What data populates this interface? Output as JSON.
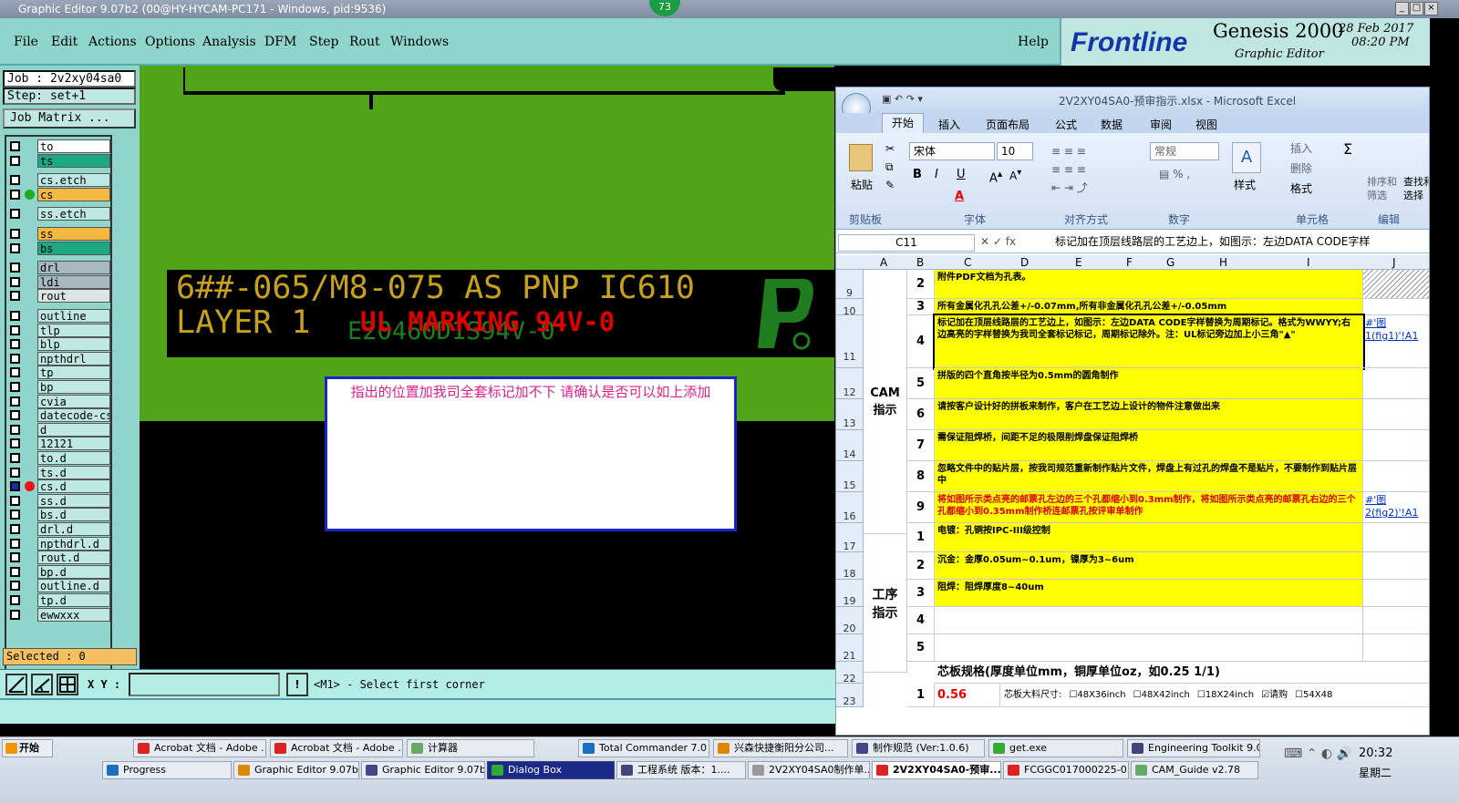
{
  "window": {
    "title": "Graphic Editor 9.07b2 (00@HY-HYCAM-PC171 - Windows, pid:9536)",
    "badge": "73"
  },
  "menu": {
    "items": [
      "File",
      "Edit",
      "Actions",
      "Options",
      "Analysis",
      "DFM",
      "Step",
      "Rout",
      "Windows"
    ],
    "help": "Help"
  },
  "brand": {
    "logo": "Frontline",
    "product": "Genesis 2000",
    "subtitle": "Graphic Editor",
    "date": "28 Feb 2017",
    "time": "08:20 PM"
  },
  "left": {
    "job": "Job : 2v2xy04sa0",
    "step": "Step: set+1",
    "job_matrix": "Job Matrix ...",
    "selected": "Selected : 0"
  },
  "layers": [
    {
      "name": "to",
      "color": "#ffffff"
    },
    {
      "name": "ts",
      "color": "#1ea884"
    },
    {
      "name": "cs.etch",
      "color": "#bfe8e3"
    },
    {
      "name": "cs",
      "color": "#f5b942"
    },
    {
      "name": "ss.etch",
      "color": "#bfe8e3"
    },
    {
      "name": "ss",
      "color": "#f5b942"
    },
    {
      "name": "bs",
      "color": "#1ea884"
    },
    {
      "name": "drl",
      "color": "#a8b8c0"
    },
    {
      "name": "ldi",
      "color": "#a8b8c0"
    },
    {
      "name": "rout",
      "color": "#dde4e6"
    },
    {
      "name": "outline",
      "color": "#bfe8e3"
    },
    {
      "name": "tlp",
      "color": "#bfe8e3"
    },
    {
      "name": "blp",
      "color": "#bfe8e3"
    },
    {
      "name": "npthdrl",
      "color": "#bfe8e3"
    },
    {
      "name": "tp",
      "color": "#bfe8e3"
    },
    {
      "name": "bp",
      "color": "#bfe8e3"
    },
    {
      "name": "cvia",
      "color": "#bfe8e3"
    },
    {
      "name": "datecode-cs",
      "color": "#bfe8e3"
    },
    {
      "name": "d",
      "color": "#bfe8e3"
    },
    {
      "name": "12121",
      "color": "#bfe8e3"
    },
    {
      "name": "to.d",
      "color": "#bfe8e3"
    },
    {
      "name": "ts.d",
      "color": "#bfe8e3"
    },
    {
      "name": "cs.d",
      "color": "#bfe8e3"
    },
    {
      "name": "ss.d",
      "color": "#bfe8e3"
    },
    {
      "name": "bs.d",
      "color": "#bfe8e3"
    },
    {
      "name": "drl.d",
      "color": "#bfe8e3"
    },
    {
      "name": "npthdrl.d",
      "color": "#bfe8e3"
    },
    {
      "name": "rout.d",
      "color": "#bfe8e3"
    },
    {
      "name": "bp.d",
      "color": "#bfe8e3"
    },
    {
      "name": "outline.d",
      "color": "#bfe8e3"
    },
    {
      "name": "tp.d",
      "color": "#bfe8e3"
    },
    {
      "name": "ewwxxx",
      "color": "#bfe8e3"
    }
  ],
  "canvas": {
    "line1": "6##-065/M8-075 AS PNP IC610",
    "line2": "LAYER 1",
    "overlay_green": "E20460D1S94V-0",
    "overlay_red": "UL MARKING 94V-0",
    "note": "指出的位置加我司全套标记加不下 请确认是否可以如上添加"
  },
  "status": {
    "xy_label": "X Y :",
    "xy_value": "",
    "prompt": "<M1> - Select first corner"
  },
  "excel": {
    "title": "2V2XY04SA0-预审指示.xlsx - Microsoft Excel",
    "tabs": [
      "开始",
      "插入",
      "页面布局",
      "公式",
      "数据",
      "审阅",
      "视图"
    ],
    "font_name": "宋体",
    "font_size": "10",
    "number_format": "常规",
    "groups": [
      "剪贴板",
      "字体",
      "对齐方式",
      "数字",
      "单元格",
      "编辑"
    ],
    "paste": "粘贴",
    "style": "样式",
    "insert": "插入",
    "delete": "删除",
    "format": "格式",
    "sort": "排序和筛选",
    "find": "查找和选择",
    "name_box": "C11",
    "formula": "标记加在顶层线路层的工艺边上，如图示：左边DATA CODE字样",
    "columns": [
      "A",
      "B",
      "C",
      "D",
      "E",
      "F",
      "G",
      "H",
      "I",
      "J"
    ],
    "rows": [
      {
        "r": "9",
        "n": "2",
        "text": "附件PDF文档为孔表。"
      },
      {
        "r": "10",
        "n": "3",
        "text": "所有金属化孔孔公差+/-0.07mm,所有非金属化孔孔公差+/-0.05mm"
      },
      {
        "r": "11",
        "n": "4",
        "text": "标记加在顶层线路层的工艺边上，如图示：左边DATA CODE字样替换为周期标记。格式为WWYY;右边高亮的字样替换为我司全套标记标记，周期标记除外。注：UL标记旁边加上小三角\"▲\""
      },
      {
        "r": "12",
        "n": "5",
        "text": "拼版的四个直角按半径为0.5mm的圆角制作"
      },
      {
        "r": "13",
        "n": "6",
        "text": "请按客户设计好的拼板来制作，客户在工艺边上设计的物件注意做出来"
      },
      {
        "r": "14",
        "n": "7",
        "text": "需保证阻焊桥，间距不足的极限削焊盘保证阻焊桥"
      },
      {
        "r": "15",
        "n": "8",
        "text": "忽略文件中的贴片层，按我司规范重新制作贴片文件，焊盘上有过孔的焊盘不是贴片，不要制作到贴片层中"
      },
      {
        "r": "16",
        "n": "9",
        "text": "将如图所示类点亮的邮票孔左边的三个孔都缩小到0.3mm制作，将如图所示类点亮的邮票孔右边的三个孔都缩小到0.35mm制作桥连邮票孔按评审单制作"
      },
      {
        "r": "17",
        "n": "1",
        "text": "电镀：孔铜按IPC-III级控制"
      },
      {
        "r": "18",
        "n": "2",
        "text": "沉金：金厚0.05um~0.1um，镍厚为3~6um"
      },
      {
        "r": "19",
        "n": "3",
        "text": "阻焊：阻焊厚度8~40um"
      },
      {
        "r": "20",
        "n": "4",
        "text": ""
      },
      {
        "r": "21",
        "n": "5",
        "text": ""
      }
    ],
    "cam_label": "CAM\n指示",
    "process_label": "工序\n指示",
    "row22": {
      "r": "22",
      "text": "芯板规格(厚度单位mm，铜厚单位oz，如0.25 1/1)"
    },
    "row23": {
      "r": "23",
      "n": "1",
      "value": "0.56",
      "label": "芯板大料尺寸:",
      "opts": [
        "48X36inch",
        "48X42inch",
        "18X24inch",
        "请购",
        "54X48"
      ]
    },
    "link1": "#'图1(fig1)'!A1",
    "link2": "#'图2(fig2)'!A1"
  },
  "taskbar": {
    "start": "开始",
    "row1": [
      "Acrobat 文档 - Adobe ...",
      "Acrobat 文档 - Adobe ...",
      "计算器",
      "Total Commander 7.0 p...",
      "兴森快捷衡阳分公司...",
      "制作规范 (Ver:1.0.6)",
      "get.exe",
      "Engineering Toolkit 9.0..."
    ],
    "row2": [
      "Progress",
      "Graphic Editor 9.07b2...",
      "Graphic Editor 9.07b...",
      "Dialog Box",
      "工程系统  版本：1....",
      "2V2XY04SA0制作单...",
      "2V2XY04SA0-预审...",
      "FCGGC017000225-0...",
      "CAM_Guide v2.78"
    ],
    "clock": "20:32",
    "day": "星期二"
  }
}
